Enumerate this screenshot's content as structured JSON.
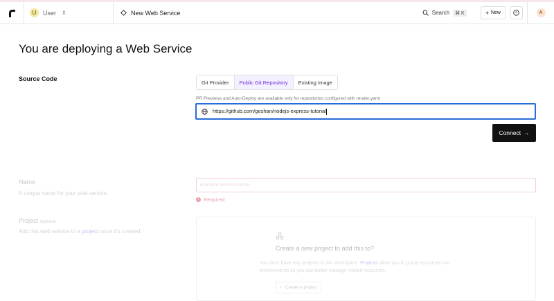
{
  "topbar": {
    "workspace_initial": "U",
    "workspace_name": "User",
    "breadcrumb": "New Web Service",
    "search_label": "Search",
    "search_shortcut": "⌘ K",
    "new_label": "New",
    "account_initial": "A"
  },
  "page": {
    "title": "You are deploying a Web Service"
  },
  "source_code": {
    "label": "Source Code",
    "tabs": [
      {
        "label": "Git Provider",
        "active": false
      },
      {
        "label": "Public Git Repository",
        "active": true
      },
      {
        "label": "Existing Image",
        "active": false
      }
    ],
    "hint": "PR Previews and Auto-Deploy are available only for repositories configured with render.yaml",
    "repo_url": "https://github.com/geshan/nodejs-express-tutorial",
    "connect_label": "Connect"
  },
  "name_section": {
    "label": "Name",
    "description": "A unique name for your web service.",
    "placeholder": "example-service-name",
    "error": "Required"
  },
  "project_section": {
    "label": "Project",
    "optional": "Optional",
    "description_prefix": "Add this web service to a",
    "description_link": "project",
    "description_suffix": "once it's created.",
    "card_title": "Create a new project to add this to?",
    "card_desc_prefix": "You don't have any projects in this workspace.",
    "card_desc_link": "Projects",
    "card_desc_suffix": "allow you to group resources into environments so you can better manage related resources.",
    "create_label": "Create a project"
  },
  "colors": {
    "accent": "#6a2bd9",
    "focus_border": "#2a6ad8",
    "button_bg": "#111111",
    "error": "#e6a0ab"
  }
}
